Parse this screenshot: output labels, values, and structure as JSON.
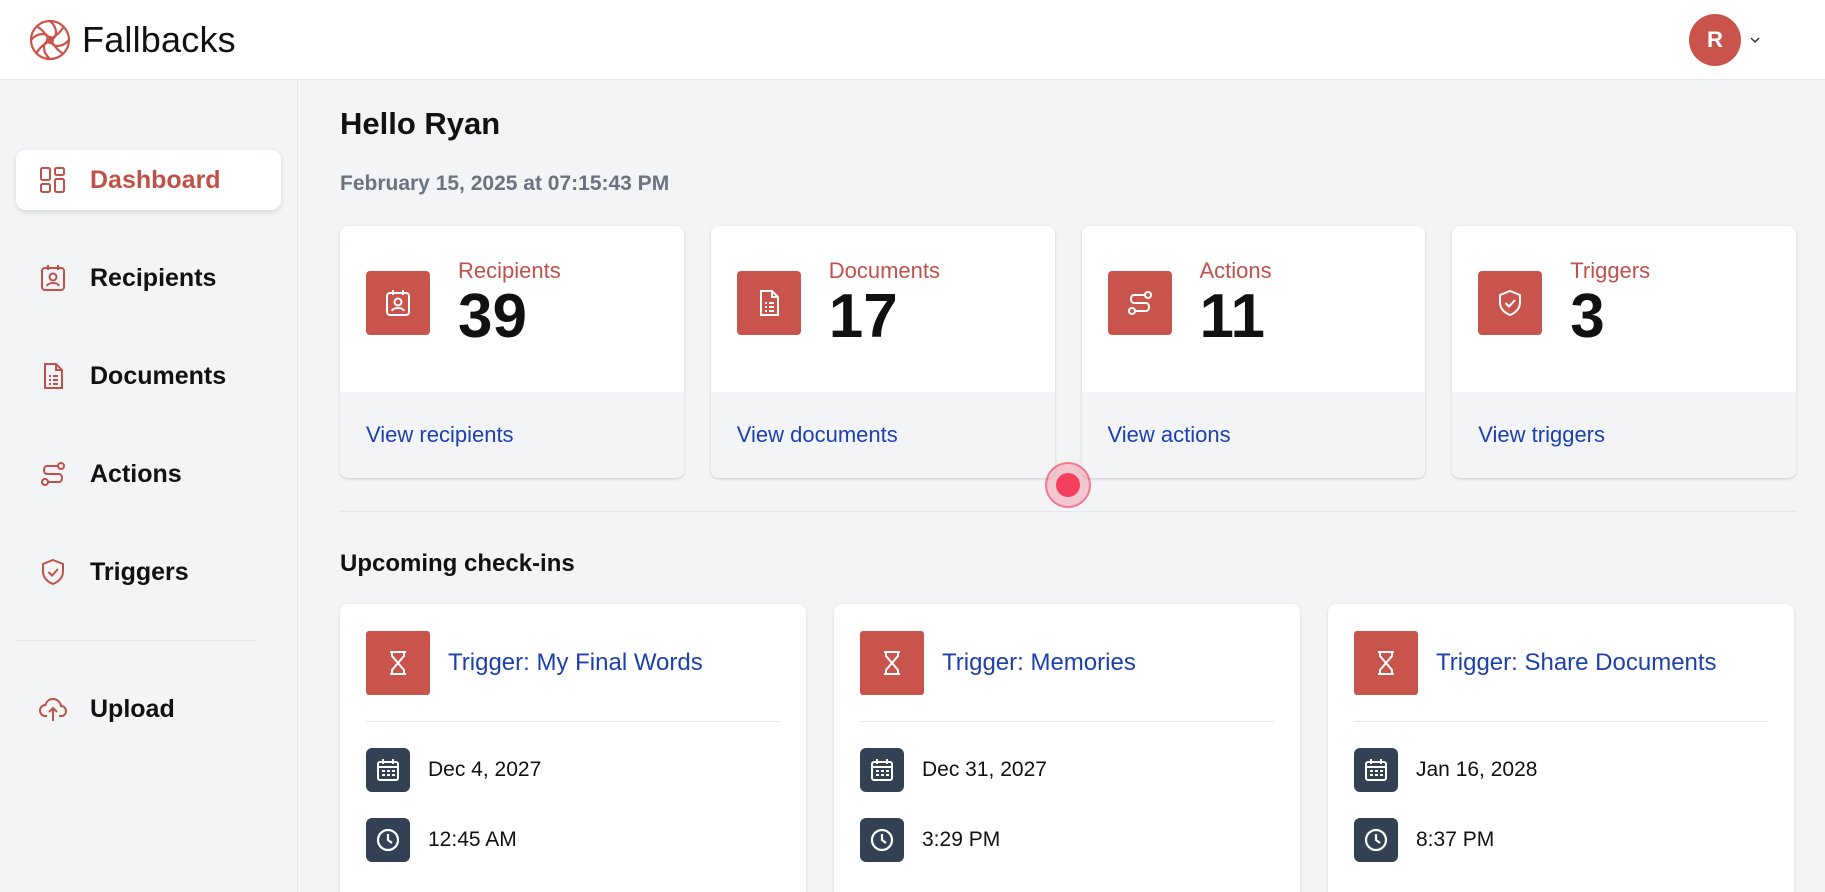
{
  "app": {
    "name": "Fallbacks"
  },
  "user": {
    "initial": "R"
  },
  "sidebar": {
    "items": [
      {
        "label": "Dashboard",
        "icon": "dashboard-icon",
        "active": true
      },
      {
        "label": "Recipients",
        "icon": "recipient-icon"
      },
      {
        "label": "Documents",
        "icon": "document-icon"
      },
      {
        "label": "Actions",
        "icon": "actions-icon"
      },
      {
        "label": "Triggers",
        "icon": "shield-icon"
      },
      {
        "label": "Upload",
        "icon": "upload-icon"
      }
    ]
  },
  "main": {
    "greeting": "Hello Ryan",
    "timestamp": "February 15, 2025 at 07:15:43 PM",
    "stats": [
      {
        "label": "Recipients",
        "value": "39",
        "link": "View recipients"
      },
      {
        "label": "Documents",
        "value": "17",
        "link": "View documents"
      },
      {
        "label": "Actions",
        "value": "11",
        "link": "View actions"
      },
      {
        "label": "Triggers",
        "value": "3",
        "link": "View triggers"
      }
    ],
    "upcoming_title": "Upcoming check-ins",
    "checkins": [
      {
        "title": "Trigger: My Final Words",
        "date": "Dec 4, 2027",
        "time": "12:45 AM"
      },
      {
        "title": "Trigger: Memories",
        "date": "Dec 31, 2027",
        "time": "3:29 PM"
      },
      {
        "title": "Trigger: Share Documents",
        "date": "Jan 16, 2028",
        "time": "8:37 PM"
      }
    ]
  },
  "colors": {
    "accent": "#c9544b",
    "link": "#1e40af",
    "icon_dark": "#334155"
  }
}
